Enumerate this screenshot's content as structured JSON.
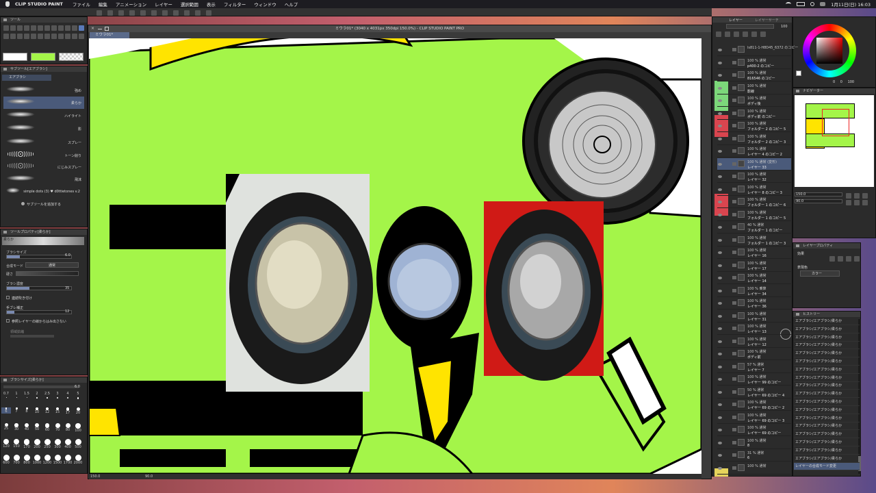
{
  "menubar": {
    "apple": "",
    "app": "CLIP STUDIO PAINT",
    "items": [
      "ファイル",
      "編集",
      "アニメーション",
      "レイヤー",
      "選択範囲",
      "表示",
      "フィルター",
      "ウィンドウ",
      "ヘルプ"
    ],
    "datetime": "1月11日(日) 16:03"
  },
  "window": {
    "title": "ミウラ01* (3040 x 4031px 350dpi 150.0%) - CLIP STUDIO PAINT PRO",
    "tab": "ミウラ01*"
  },
  "tool_panel": {
    "title": "ツール"
  },
  "subtool": {
    "title": "サブツール[エアブラシ]",
    "tab": "エアブラシ",
    "brushes": [
      "強め",
      "柔らか",
      "ハイライト",
      "影",
      "スプレー",
      "トーン削り",
      "にじみスプレー",
      "飛沫",
      "simple dots (3) ♥ d0ttietones v.2"
    ],
    "add_label": "サブツールを追加する"
  },
  "tool_property": {
    "title": "ツールプロパティ[柔らか]",
    "brush_label": "柔らか",
    "brush_size_label": "ブラシサイズ",
    "brush_size_value": "6.0",
    "blend_label": "合成モード",
    "blend_value": "通常",
    "hardness_label": "硬さ",
    "density_label": "ブラシ濃度",
    "density_value": "35",
    "continuous_label": "連続吹き付け",
    "correction_label": "手ブレ補正",
    "correction_value": "12",
    "reference_label": "参照レイヤーの線からはみ出さない",
    "reference_sub": "領域拡縮"
  },
  "brush_size_panel": {
    "title": "ブラシサイズ[柔らか]",
    "value": "6.0",
    "sizes": [
      "0.7",
      "1",
      "1.5",
      "2",
      "2.5",
      "3",
      "4",
      "5",
      "6",
      "7",
      "8",
      "10",
      "12",
      "15",
      "17",
      "20",
      "25",
      "30",
      "40",
      "50",
      "60",
      "70",
      "80",
      "100",
      "120",
      "150",
      "170",
      "200",
      "250",
      "300",
      "400",
      "500",
      "600",
      "700",
      "800",
      "1000",
      "1200",
      "1500",
      "1700",
      "2000"
    ]
  },
  "layer_panel": {
    "tab1": "レイヤー",
    "tab2": "レイヤーサーチ",
    "opacity": "100",
    "layers": [
      {
        "l1": "ls811-1-H8D45_6372 のコピー",
        "l2": ""
      },
      {
        "l1": "100 % 通常",
        "l2": "p400-2 のコピー"
      },
      {
        "l1": "100 % 通常",
        "l2": "816546 のコピー"
      },
      {
        "l1": "100 % 通常",
        "l2": "影線"
      },
      {
        "l1": "100 % 通常",
        "l2": "ボディ後"
      },
      {
        "l1": "100 % 通常",
        "l2": "ボディ前 のコピー"
      },
      {
        "l1": "100 % 通常",
        "l2": "フォルダー 2 のコピー 5"
      },
      {
        "l1": "100 % 通常",
        "l2": "フォルダー 2 のコピー 3"
      },
      {
        "l1": "100 % 通常",
        "l2": "レイヤー 4 のコピー 2"
      },
      {
        "l1": "100 % 通常 (変形)",
        "l2": "レイヤー 33"
      },
      {
        "l1": "100 % 通常",
        "l2": "レイヤー 32"
      },
      {
        "l1": "100 % 通常",
        "l2": "レイヤー 8 のコピー 3"
      },
      {
        "l1": "100 % 通常",
        "l2": "フォルダー 1 のコピー 6"
      },
      {
        "l1": "100 % 通常",
        "l2": "フォルダー 1 のコピー 5"
      },
      {
        "l1": "40 % 通常",
        "l2": "フォルダー 1 のコピー"
      },
      {
        "l1": "100 % 通常",
        "l2": "フォルダー 1 のコピー 3"
      },
      {
        "l1": "100 % 通常",
        "l2": "レイヤー 16"
      },
      {
        "l1": "100 % 通常",
        "l2": "レイヤー 17"
      },
      {
        "l1": "100 % 通常",
        "l2": "レイヤー 14"
      },
      {
        "l1": "100 % 乗算",
        "l2": "レイヤー 34"
      },
      {
        "l1": "100 % 通常",
        "l2": "レイヤー 36"
      },
      {
        "l1": "100 % 通常",
        "l2": "レイヤー 31"
      },
      {
        "l1": "100 % 通常",
        "l2": "レイヤー 13"
      },
      {
        "l1": "100 % 通常",
        "l2": "レイヤー 12"
      },
      {
        "l1": "100 % 通常",
        "l2": "ボディ前"
      },
      {
        "l1": "57 % 通常",
        "l2": "レイヤー 7"
      },
      {
        "l1": "100 % 通常",
        "l2": "レイヤー 99 のコピー"
      },
      {
        "l1": "50 % 通常",
        "l2": "レイヤー 69 のコピー 4"
      },
      {
        "l1": "100 % 通常",
        "l2": "レイヤー 69 のコピー 2"
      },
      {
        "l1": "100 % 通常",
        "l2": "レイヤー 69 のコピー 3"
      },
      {
        "l1": "100 % 通常",
        "l2": "レイヤー 69 のコピー"
      },
      {
        "l1": "100 % 通常",
        "l2": "8"
      },
      {
        "l1": "31 % 通常",
        "l2": "6"
      },
      {
        "l1": "100 % 通常",
        "l2": ""
      }
    ]
  },
  "navigator": {
    "title": "ナビゲーター",
    "zoom": "150.0",
    "rotate": "90.0"
  },
  "color": {
    "value1": "0",
    "value2": "0",
    "value3": "100"
  },
  "layer_property": {
    "title": "レイヤープロパティ",
    "effect_label": "効果",
    "color_label": "表現色",
    "color_value": "カラー"
  },
  "history": {
    "title": "ヒストリー",
    "items": [
      "エアブラシ/エアブラシ/柔らか",
      "エアブラシ/エアブラシ/柔らか",
      "エアブラシ/エアブラシ/柔らか",
      "エアブラシ/エアブラシ/柔らか",
      "エアブラシ/エアブラシ/柔らか",
      "エアブラシ/エアブラシ/柔らか",
      "エアブラシ/エアブラシ/柔らか",
      "エアブラシ/エアブラシ/柔らか",
      "エアブラシ/エアブラシ/柔らか",
      "エアブラシ/エアブラシ/柔らか",
      "エアブラシ/エアブラシ/柔らか",
      "エアブラシ/エアブラシ/柔らか",
      "エアブラシ/エアブラシ/柔らか",
      "エアブラシ/エアブラシ/柔らか",
      "エアブラシ/エアブラシ/柔らか",
      "エアブラシ/エアブラシ/柔らか",
      "エアブラシ/エアブラシ/柔らか",
      "エアブラシ/エアブラシ/柔らか",
      "レイヤーの合成モード変更"
    ]
  },
  "statusbar": {
    "zoom": "150.0",
    "angle": "90.0"
  },
  "colors": {
    "lime": "#a4f549",
    "main_fg": "#ffffff",
    "main_bg": "#a4f549"
  }
}
